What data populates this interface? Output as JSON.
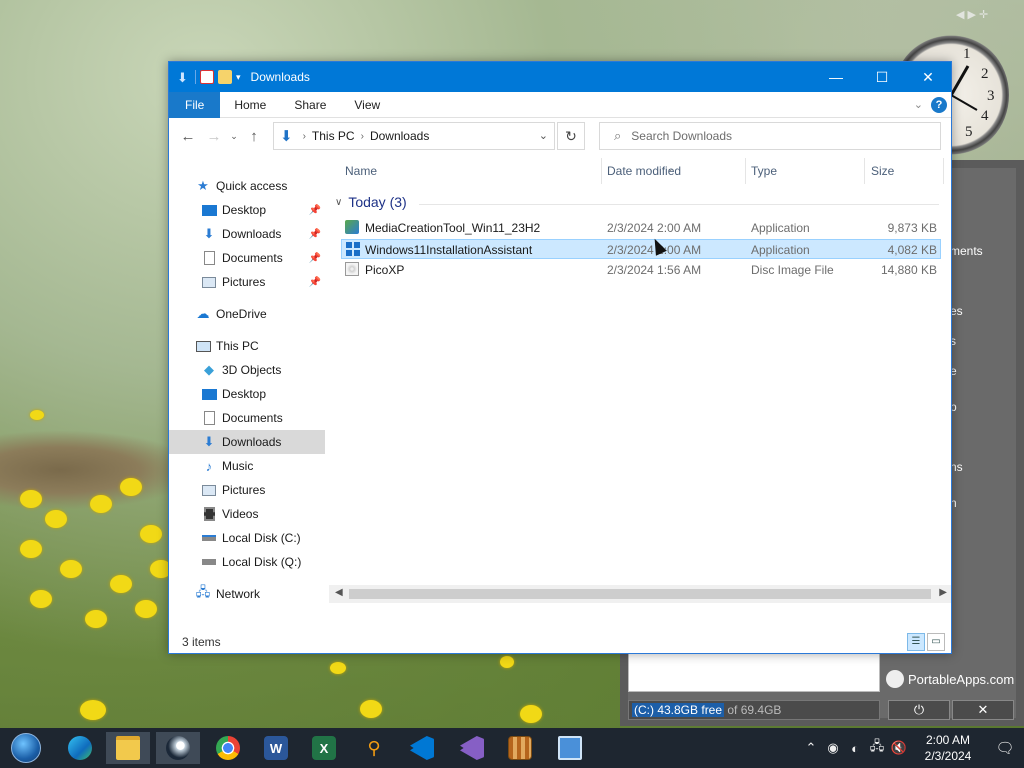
{
  "window": {
    "title": "Downloads",
    "controls": {
      "minimize": "—",
      "maximize": "☐",
      "close": "✕"
    }
  },
  "ribbon": {
    "tabs": [
      "File",
      "Home",
      "Share",
      "View"
    ],
    "help": "?"
  },
  "address": {
    "crumbs": [
      "This PC",
      "Downloads"
    ]
  },
  "search": {
    "placeholder": "Search Downloads"
  },
  "nav": {
    "quick_access": "Quick access",
    "qa_items": [
      "Desktop",
      "Downloads",
      "Documents",
      "Pictures"
    ],
    "onedrive": "OneDrive",
    "this_pc": "This PC",
    "pc_items": [
      "3D Objects",
      "Desktop",
      "Documents",
      "Downloads",
      "Music",
      "Pictures",
      "Videos",
      "Local Disk (C:)",
      "Local Disk (Q:)"
    ],
    "network": "Network"
  },
  "columns": {
    "name": "Name",
    "date": "Date modified",
    "type": "Type",
    "size": "Size"
  },
  "group": {
    "label": "Today (3)"
  },
  "files": [
    {
      "name": "MediaCreationTool_Win11_23H2",
      "date": "2/3/2024 2:00 AM",
      "type": "Application",
      "size": "9,873 KB"
    },
    {
      "name": "Windows11InstallationAssistant",
      "date": "2/3/2024 2:00 AM",
      "type": "Application",
      "size": "4,082 KB"
    },
    {
      "name": "PicoXP",
      "date": "2/3/2024 1:56 AM",
      "type": "Disc Image File",
      "size": "14,880 KB"
    }
  ],
  "status": {
    "count": "3 items"
  },
  "portableapps": {
    "menu_fragments": [
      "ments",
      "es",
      "s",
      "e",
      "p",
      "ns",
      "n"
    ],
    "brand": "PortableApps.com",
    "disk_free": "(C:) 43.8GB free",
    "disk_total": " of 69.4GB",
    "power": "⏻",
    "close": "✕"
  },
  "clock_numbers": [
    "1",
    "2",
    "3",
    "4",
    "5"
  ],
  "tray": {
    "time": "2:00 AM",
    "date": "2/3/2024"
  },
  "taskbar": {
    "apps": [
      "start",
      "edge",
      "file-explorer",
      "steam",
      "chrome",
      "word",
      "excel",
      "search-tool",
      "vscode",
      "visual-studio",
      "archive-tool",
      "remote-desktop"
    ]
  },
  "colors": {
    "accent": "#0078d7",
    "selection": "#cce8ff",
    "taskbar": "#1e2630"
  }
}
